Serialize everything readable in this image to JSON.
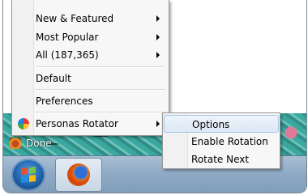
{
  "menu": {
    "items": [
      {
        "label": "New & Featured",
        "has_submenu": true
      },
      {
        "label": "Most Popular",
        "has_submenu": true
      },
      {
        "label": "All (187,365)",
        "has_submenu": true
      },
      {
        "label": "Default",
        "has_submenu": false
      },
      {
        "label": "Preferences",
        "has_submenu": false
      },
      {
        "label": "Personas Rotator",
        "has_submenu": true,
        "icon": "personas-rotator-icon"
      }
    ]
  },
  "submenu": {
    "items": [
      {
        "label": "Options",
        "highlighted": true
      },
      {
        "label": "Enable Rotation",
        "highlighted": false
      },
      {
        "label": "Rotate Next",
        "highlighted": false
      }
    ]
  },
  "statusbar": {
    "text": "Done",
    "icon": "personas-status-icon"
  },
  "taskbar": {
    "start_icon": "windows-start-icon",
    "buttons": [
      {
        "name": "Firefox",
        "icon": "firefox-icon"
      }
    ]
  },
  "colors": {
    "menu_bg": "#f7f7f7",
    "highlight_border": "#a8c4e4",
    "taskbar": "#8da9c4",
    "persona_teal": "#3aa8a0"
  }
}
